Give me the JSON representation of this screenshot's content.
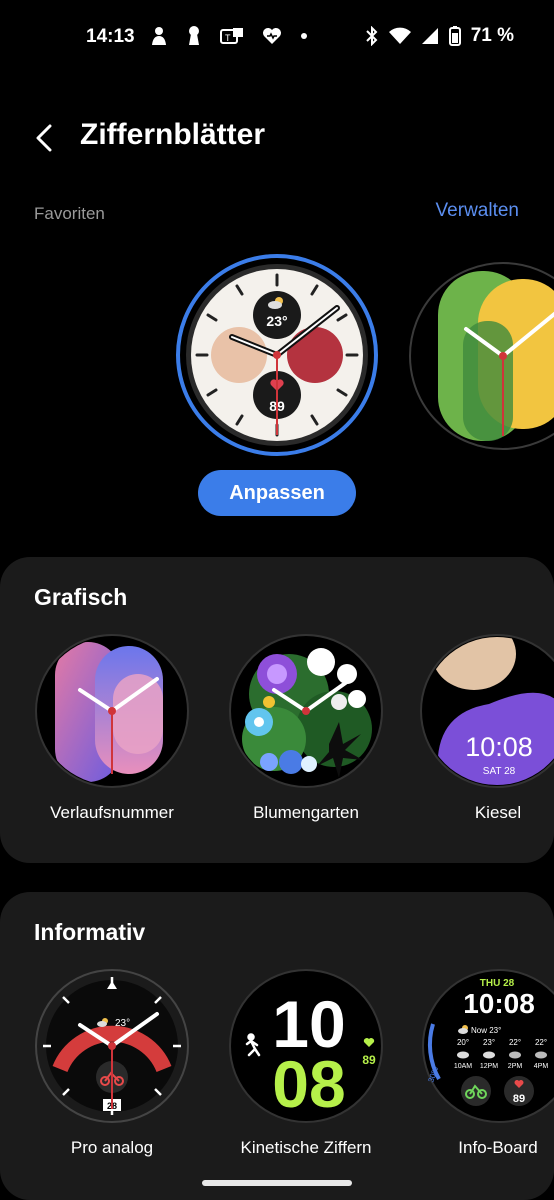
{
  "status_bar": {
    "time": "14:13",
    "battery": "71 %",
    "left_icons": [
      "person-icon",
      "keyhole-icon",
      "notification-icon",
      "heart-icon",
      "dot-icon"
    ],
    "right_icons": [
      "bluetooth-icon",
      "wifi-icon",
      "signal-icon",
      "battery-icon"
    ]
  },
  "header": {
    "title": "Ziffernblätter"
  },
  "favorites": {
    "label": "Favoriten",
    "manage_label": "Verwalten",
    "selected_face": {
      "temperature": "23°",
      "heart_rate": "89"
    },
    "customize_label": "Anpassen"
  },
  "sections": {
    "graphic": {
      "title": "Grafisch",
      "items": [
        {
          "label": "Verlaufsnummer"
        },
        {
          "label": "Blumengarten"
        },
        {
          "label": "Kiesel",
          "time": "10:08",
          "date": "SAT 28"
        }
      ]
    },
    "informative": {
      "title": "Informativ",
      "items": [
        {
          "label": "Pro analog",
          "temperature": "23°",
          "date": "28"
        },
        {
          "label": "Kinetische Ziffern",
          "hour": "10",
          "minute": "08",
          "heart_rate": "89"
        },
        {
          "label": "Info-Board",
          "date": "THU 28",
          "time": "10:08",
          "now": "Now 23°",
          "battery": "30%",
          "heart_rate": "89",
          "forecast": [
            {
              "temp": "20°",
              "time": "10AM"
            },
            {
              "temp": "23°",
              "time": "12PM"
            },
            {
              "temp": "22°",
              "time": "2PM"
            },
            {
              "temp": "22°",
              "time": "4PM"
            }
          ]
        }
      ]
    }
  },
  "colors": {
    "accent": "#3b7de9",
    "link": "#5b8ef0",
    "card": "#1b1b1b"
  }
}
